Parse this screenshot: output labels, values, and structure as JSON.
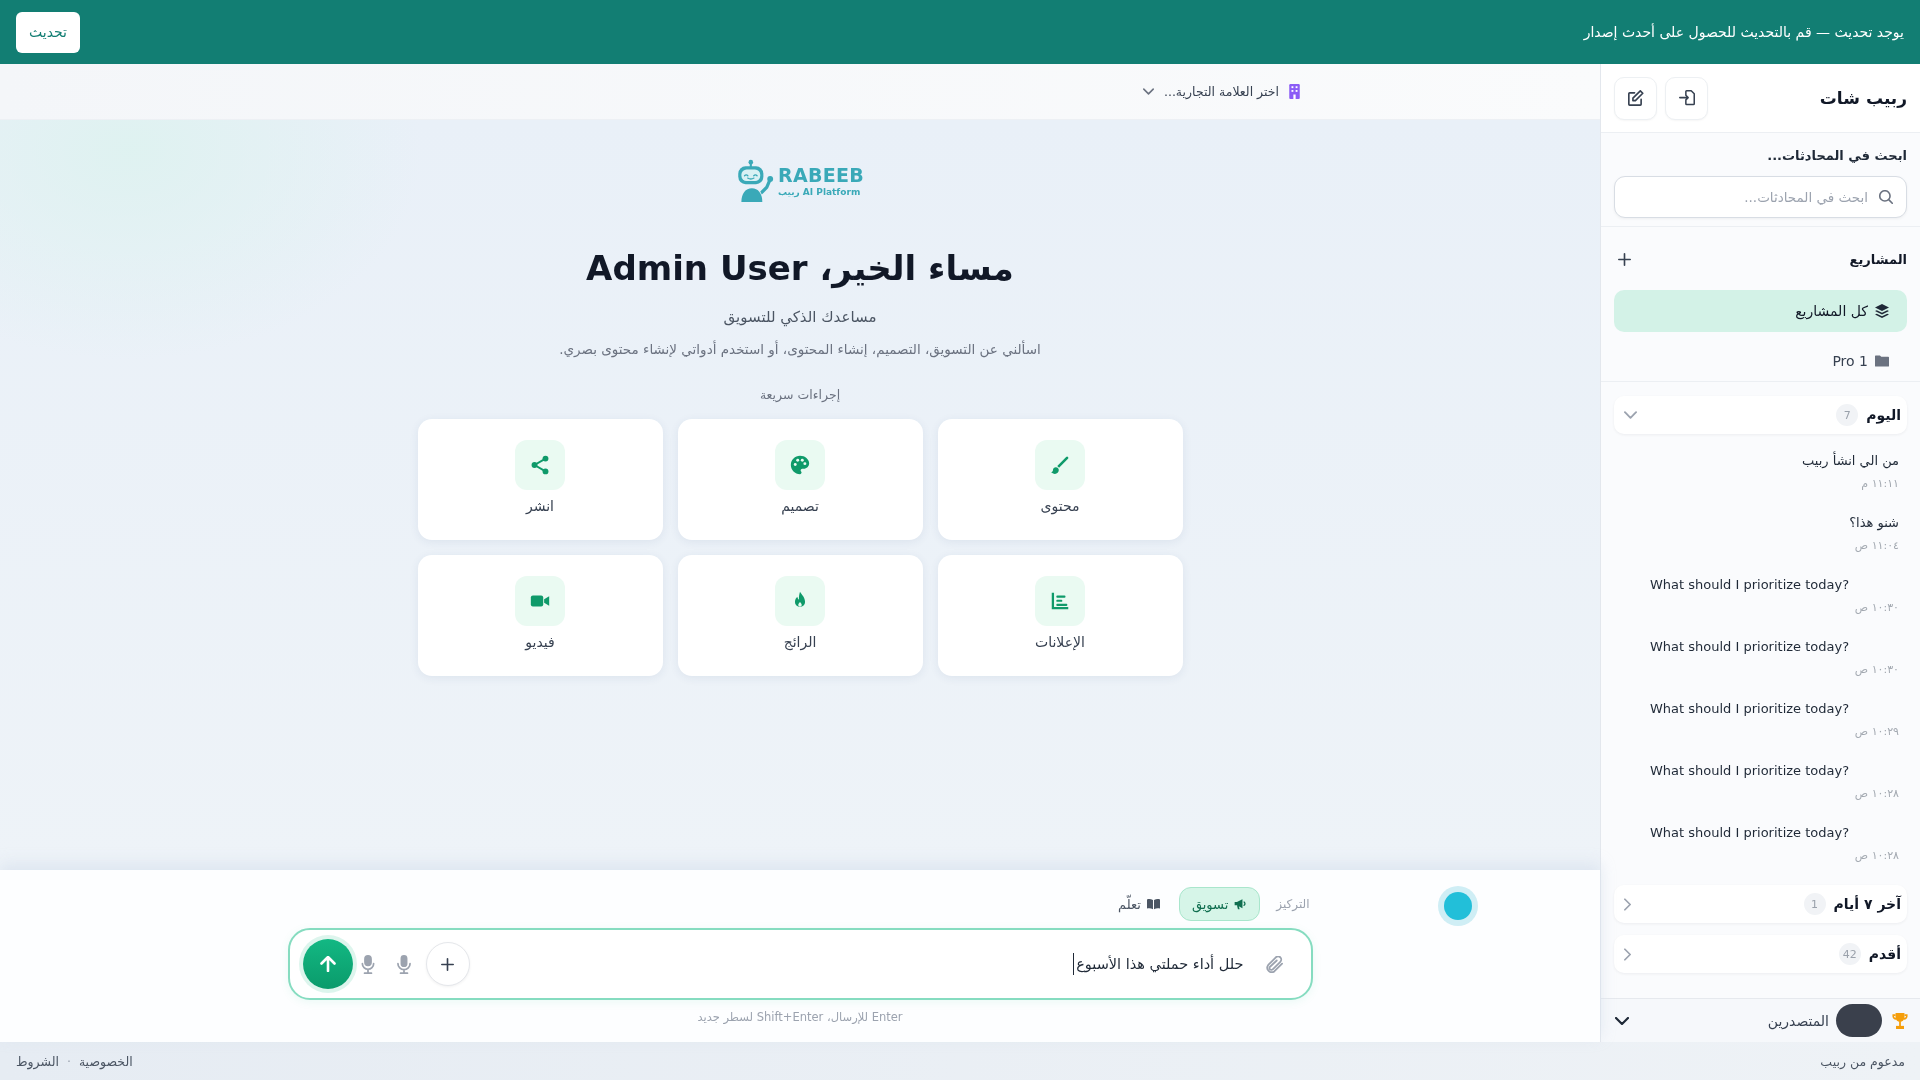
{
  "update_banner": {
    "message": "يوجد تحديث — قم بالتحديث للحصول على أحدث إصدار",
    "button": "تحديث"
  },
  "sidebar": {
    "title": "ربيب شات",
    "search": {
      "label": "ابحث في المحادثات...",
      "placeholder": "ابحث في المحادثات..."
    },
    "projects": {
      "title": "المشاريع",
      "items": [
        {
          "name": "كل المشاريع",
          "selected": true
        },
        {
          "name": "Pro 1",
          "selected": false
        }
      ]
    },
    "groups": [
      {
        "title": "اليوم",
        "count": "7",
        "expanded": true,
        "chats": [
          {
            "title": "من الي انشأ ربيب",
            "time": "١١:١١ م"
          },
          {
            "title": "شنو هذا؟",
            "time": "١١:٠٤ ص"
          },
          {
            "title": "What should I prioritize today?",
            "time": "١٠:٣٠ ص"
          },
          {
            "title": "What should I prioritize today?",
            "time": "١٠:٣٠ ص"
          },
          {
            "title": "What should I prioritize today?",
            "time": "١٠:٢٩ ص"
          },
          {
            "title": "What should I prioritize today?",
            "time": "١٠:٢٨ ص"
          },
          {
            "title": "What should I prioritize today?",
            "time": "١٠:٢٨ ص"
          }
        ]
      },
      {
        "title": "آخر ٧ أيام",
        "count": "1",
        "expanded": false
      },
      {
        "title": "أقدم",
        "count": "42",
        "expanded": false
      }
    ],
    "leaderboard": {
      "title": "المتصدرين",
      "expanded": true
    }
  },
  "header": {
    "brand_selector": {
      "label": "اختر العلامة التجارية..."
    }
  },
  "hero": {
    "logo": {
      "wordmark": "RABEEB",
      "tagline": "ربيب AI Platform"
    },
    "greeting": "مساء الخير، Admin User",
    "subtitle": "مساعدك الذكي للتسويق",
    "description": "اسألني عن التسويق، التصميم، إنشاء المحتوى، أو استخدم أدواتي لإنشاء محتوى بصري.",
    "quick_actions_title": "إجراءات سريعة"
  },
  "quick_actions": [
    {
      "label": "محتوى"
    },
    {
      "label": "تصميم"
    },
    {
      "label": "انشر"
    },
    {
      "label": "الإعلانات"
    },
    {
      "label": "الرائج"
    },
    {
      "label": "فيديو"
    }
  ],
  "composer": {
    "focus_label": "التركيز",
    "modes": [
      {
        "label": "تسويق",
        "selected": true
      },
      {
        "label": "تعلّم",
        "selected": false
      }
    ],
    "input": {
      "value": "حلل أداء حملتي هذا الأسبوع"
    },
    "hint": "Enter للإرسال، Shift+Enter لسطر جديد"
  },
  "footer": {
    "powered_by": "مدعوم من ربيب",
    "links": [
      "الخصوصية",
      "الشروط"
    ],
    "separator": "·"
  }
}
